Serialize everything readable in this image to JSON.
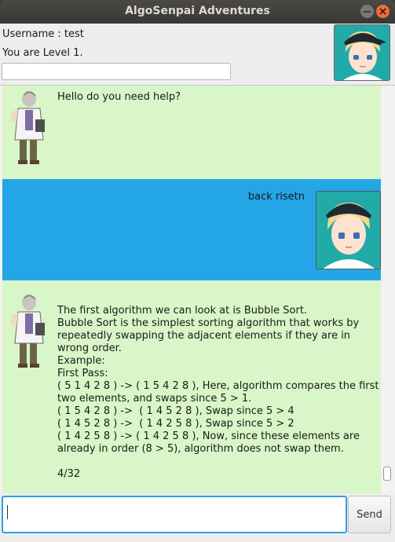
{
  "window": {
    "title": "AlgoSenpai Adventures"
  },
  "header": {
    "username_label": "Username : test",
    "level_label": "You are Level 1.",
    "avatar_icon": "trainer-girl-avatar"
  },
  "messages": [
    {
      "sender": "bot",
      "text": "Hello do you need help?"
    },
    {
      "sender": "user",
      "text": "back risetn"
    },
    {
      "sender": "bot",
      "text": "The first algorithm we can look at is Bubble Sort.\nBubble Sort is the simplest sorting algorithm that works by repeatedly swapping the adjacent elements if they are in wrong order.\nExample:\nFirst Pass:\n( 5 1 4 2 8 ) -> ( 1 5 4 2 8 ), Here, algorithm compares the first two elements, and swaps since 5 > 1.\n( 1 5 4 2 8 ) ->  ( 1 4 5 2 8 ), Swap since 5 > 4\n( 1 4 5 2 8 ) ->  ( 1 4 2 5 8 ), Swap since 5 > 2\n( 1 4 2 5 8 ) -> ( 1 4 2 5 8 ), Now, since these elements are already in order (8 > 5), algorithm does not swap them.\n\n4/32"
    }
  ],
  "input": {
    "value": "",
    "send_label": "Send"
  },
  "colors": {
    "bot_bubble": "#d8f6c8",
    "user_bubble": "#24a6e6",
    "focus_border": "#2f9fdf"
  }
}
